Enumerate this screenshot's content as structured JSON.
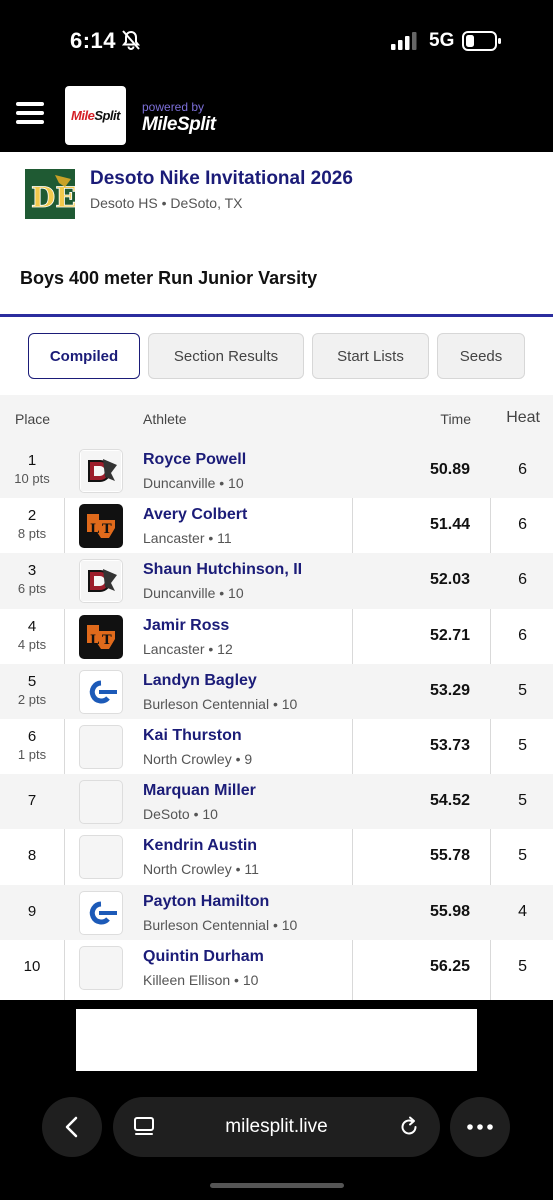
{
  "status_bar": {
    "time": "6:14",
    "network": "5G"
  },
  "header": {
    "logo_red": "Mile",
    "logo_dark": "Split",
    "powered_by": "powered by",
    "powered_logo": "MileSplit"
  },
  "meet": {
    "logo_letters": "DE",
    "title": "Desoto Nike Invitational 2026",
    "subtitle": "Desoto HS • DeSoto, TX"
  },
  "event": {
    "title": "Boys 400 meter Run Junior Varsity"
  },
  "tabs": [
    {
      "label": "Compiled",
      "active": true
    },
    {
      "label": "Section Results",
      "active": false
    },
    {
      "label": "Start Lists",
      "active": false
    },
    {
      "label": "Seeds",
      "active": false
    }
  ],
  "table": {
    "headers": {
      "place": "Place",
      "athlete": "Athlete",
      "time": "Time",
      "heat": "Heat"
    },
    "rows": [
      {
        "place": "1",
        "points": "10 pts",
        "name": "Royce Powell",
        "team": "Duncanville • 10",
        "time": "50.89",
        "heat": "6",
        "logo": "duncanville"
      },
      {
        "place": "2",
        "points": "8 pts",
        "name": "Avery Colbert",
        "team": "Lancaster • 11",
        "time": "51.44",
        "heat": "6",
        "logo": "lancaster"
      },
      {
        "place": "3",
        "points": "6 pts",
        "name": "Shaun Hutchinson, II",
        "team": "Duncanville • 10",
        "time": "52.03",
        "heat": "6",
        "logo": "duncanville"
      },
      {
        "place": "4",
        "points": "4 pts",
        "name": "Jamir Ross",
        "team": "Lancaster • 12",
        "time": "52.71",
        "heat": "6",
        "logo": "lancaster"
      },
      {
        "place": "5",
        "points": "2 pts",
        "name": "Landyn Bagley",
        "team": "Burleson Centennial • 10",
        "time": "53.29",
        "heat": "5",
        "logo": "burleson"
      },
      {
        "place": "6",
        "points": "1 pts",
        "name": "Kai Thurston",
        "team": "North Crowley • 9",
        "time": "53.73",
        "heat": "5",
        "logo": "none"
      },
      {
        "place": "7",
        "points": "",
        "name": "Marquan Miller",
        "team": "DeSoto • 10",
        "time": "54.52",
        "heat": "5",
        "logo": "none"
      },
      {
        "place": "8",
        "points": "",
        "name": "Kendrin Austin",
        "team": "North Crowley • 11",
        "time": "55.78",
        "heat": "5",
        "logo": "none"
      },
      {
        "place": "9",
        "points": "",
        "name": "Payton Hamilton",
        "team": "Burleson Centennial • 10",
        "time": "55.98",
        "heat": "4",
        "logo": "burleson"
      },
      {
        "place": "10",
        "points": "",
        "name": "Quintin Durham",
        "team": "Killeen Ellison • 10",
        "time": "56.25",
        "heat": "5",
        "logo": "none"
      }
    ]
  },
  "browser": {
    "url": "milesplit.live"
  }
}
